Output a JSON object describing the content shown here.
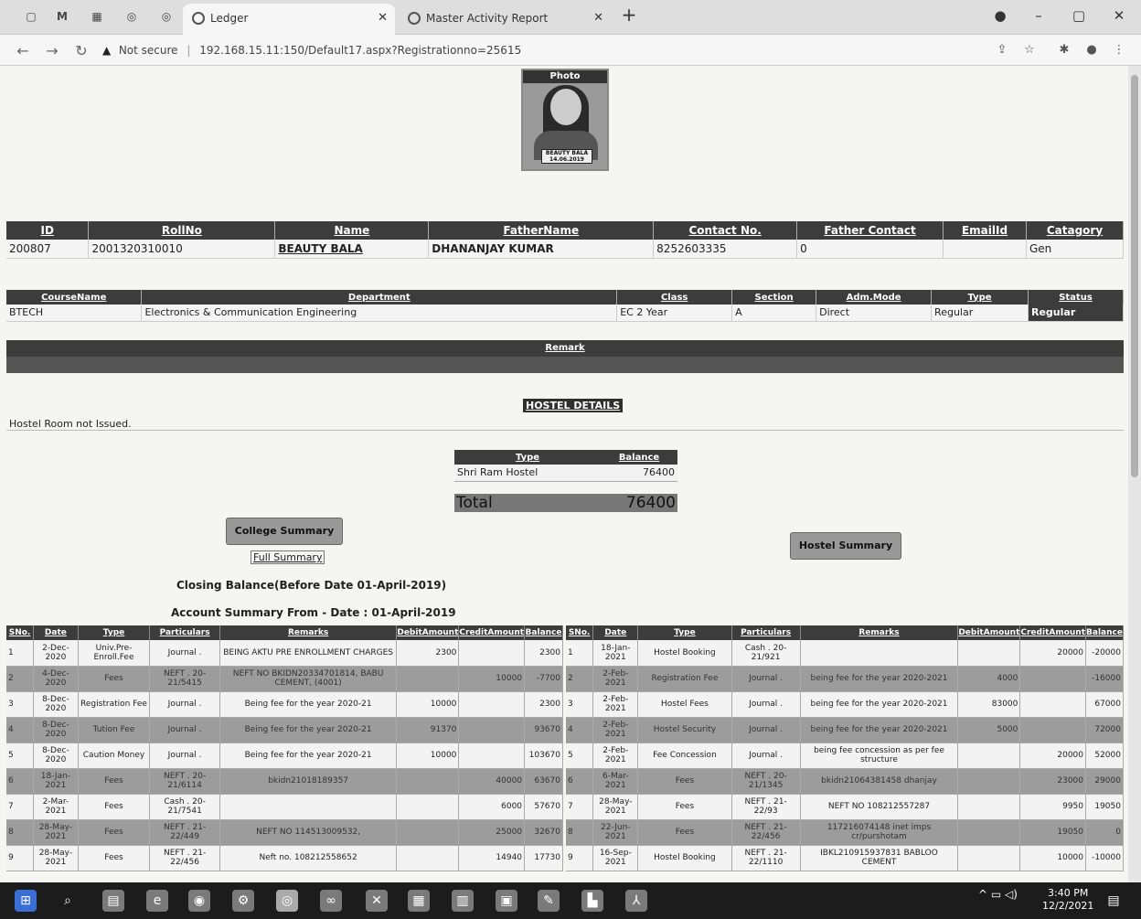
{
  "browser": {
    "pinned_tabs": [
      "M"
    ],
    "tabs": [
      {
        "title": "Ledger",
        "active": true
      },
      {
        "title": "Master Activity Report",
        "active": false
      }
    ],
    "new_tab_label": "+",
    "url_warning": "Not secure",
    "url": "192.168.15.11:150/Default17.aspx?Registrationno=25615"
  },
  "photo": {
    "title": "Photo",
    "plate_text": "BEAUTY BALA 14.06.2019"
  },
  "student_table": {
    "headers": [
      "ID",
      "RollNo",
      "Name",
      "FatherName",
      "Contact No.",
      "Father Contact",
      "EmailId",
      "Catagory"
    ],
    "row": [
      "200807",
      "2001320310010",
      "BEAUTY BALA",
      "DHANANJAY KUMAR",
      "8252603335",
      "0",
      "",
      "Gen"
    ]
  },
  "course_table": {
    "headers": [
      "CourseName",
      "Department",
      "Class",
      "Section",
      "Adm.Mode",
      "Type",
      "Status"
    ],
    "row": [
      "BTECH",
      "Electronics & Communication Engineering",
      "EC 2 Year",
      "A",
      "Direct",
      "Regular",
      "Regular"
    ]
  },
  "remark_label": "Remark",
  "hostel": {
    "title": "HOSTEL DETAILS",
    "message": "Hostel Room not Issued.",
    "headers": [
      "Type",
      "Balance"
    ],
    "rows": [
      [
        "Shri Ram Hostel",
        "76400"
      ]
    ],
    "total_label": "Total",
    "total_value": "76400"
  },
  "buttons": {
    "college_summary": "College Summary",
    "full_summary": "Full Summary",
    "hostel_summary": "Hostel Summary"
  },
  "closing_balance": "Closing Balance(Before Date 01-April-2019)",
  "account_summary": "Account Summary From - Date : 01-April-2019",
  "ledger_headers": [
    "SNo.",
    "Date",
    "Type",
    "Particulars",
    "Remarks",
    "DebitAmount",
    "CreditAmount",
    "Balance"
  ],
  "college_ledger": [
    [
      "1",
      "2-Dec-2020",
      "Univ.Pre-Enroll.Fee",
      "Journal .",
      "BEING AKTU PRE ENROLLMENT CHARGES",
      "2300",
      "",
      "2300"
    ],
    [
      "2",
      "4-Dec-2020",
      "Fees",
      "NEFT . 20-21/5415",
      "NEFT NO BKIDN20334701814, BABU CEMENT, (4001)",
      "",
      "10000",
      "-7700"
    ],
    [
      "3",
      "8-Dec-2020",
      "Registration Fee",
      "Journal .",
      "Being fee for the year 2020-21",
      "10000",
      "",
      "2300"
    ],
    [
      "4",
      "8-Dec-2020",
      "Tution Fee",
      "Journal .",
      "Being fee for the year 2020-21",
      "91370",
      "",
      "93670"
    ],
    [
      "5",
      "8-Dec-2020",
      "Caution Money",
      "Journal .",
      "Being fee for the year 2020-21",
      "10000",
      "",
      "103670"
    ],
    [
      "6",
      "18-Jan-2021",
      "Fees",
      "NEFT . 20-21/6114",
      "bkidn21018189357",
      "",
      "40000",
      "63670"
    ],
    [
      "7",
      "2-Mar-2021",
      "Fees",
      "Cash . 20-21/7541",
      "",
      "",
      "6000",
      "57670"
    ],
    [
      "8",
      "28-May-2021",
      "Fees",
      "NEFT . 21-22/449",
      "NEFT NO 114513009532,",
      "",
      "25000",
      "32670"
    ],
    [
      "9",
      "28-May-2021",
      "Fees",
      "NEFT . 21-22/456",
      "Neft no. 108212558652",
      "",
      "14940",
      "17730"
    ]
  ],
  "hostel_ledger": [
    [
      "1",
      "18-Jan-2021",
      "Hostel Booking",
      "Cash . 20-21/921",
      "",
      "",
      "20000",
      "-20000"
    ],
    [
      "2",
      "2-Feb-2021",
      "Registration Fee",
      "Journal .",
      "being fee for the year 2020-2021",
      "4000",
      "",
      "-16000"
    ],
    [
      "3",
      "2-Feb-2021",
      "Hostel Fees",
      "Journal .",
      "being fee for the year 2020-2021",
      "83000",
      "",
      "67000"
    ],
    [
      "4",
      "2-Feb-2021",
      "Hostel Security",
      "Journal .",
      "being fee for the year 2020-2021",
      "5000",
      "",
      "72000"
    ],
    [
      "5",
      "2-Feb-2021",
      "Fee Concession",
      "Journal .",
      "being fee concession as per fee structure",
      "",
      "20000",
      "52000"
    ],
    [
      "6",
      "6-Mar-2021",
      "Fees",
      "NEFT . 20-21/1345",
      "bkidn21064381458 dhanjay",
      "",
      "23000",
      "29000"
    ],
    [
      "7",
      "28-May-2021",
      "Fees",
      "NEFT . 21-22/93",
      "NEFT NO 108212557287",
      "",
      "9950",
      "19050"
    ],
    [
      "8",
      "22-Jun-2021",
      "Fees",
      "NEFT . 21-22/456",
      "117216074148 inet imps cr/purshotam",
      "",
      "19050",
      "0"
    ],
    [
      "9",
      "16-Sep-2021",
      "Hostel Booking",
      "NEFT . 21-22/1110",
      "IBKL210915937831 BABLOO CEMENT",
      "",
      "10000",
      "-10000"
    ]
  ],
  "taskbar": {
    "time": "3:40 PM",
    "date": "12/2/2021"
  }
}
